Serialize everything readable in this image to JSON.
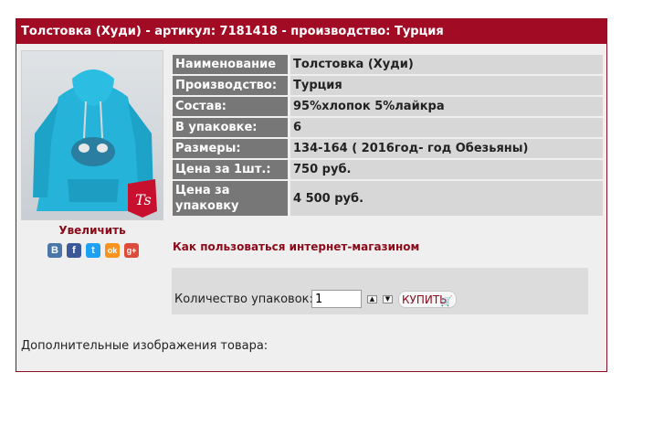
{
  "product": {
    "header": "Толстовка (Худи) - артикул: 7181418 - производство: Турция",
    "enlarge_label": "Увеличить",
    "specs": [
      {
        "key": "Наименование",
        "value": "Толстовка (Худи)"
      },
      {
        "key": "Производство:",
        "value": "Турция"
      },
      {
        "key": "Состав:",
        "value": "95%хлопок 5%лайкра"
      },
      {
        "key": "В упаковке:",
        "value": "6"
      },
      {
        "key": "Размеры:",
        "value": "134-164 ( 2016год- год Обезьяны)"
      },
      {
        "key": "Цена за 1шт.:",
        "value": "750 руб."
      },
      {
        "key": "Цена за упаковку",
        "value": "4 500 руб."
      }
    ],
    "howto_link": "Как пользоваться интернет-магазином",
    "qty_label": "Количество упаковок:",
    "qty_value": "1",
    "buy_label": "КУПИТЬ",
    "extra_images_label": "Дополнительные изображения товара:"
  },
  "social": [
    {
      "letter": "В",
      "icon": "vk-icon",
      "color": "#4a76a8"
    },
    {
      "letter": "f",
      "icon": "facebook-icon",
      "color": "#3b5998"
    },
    {
      "letter": "t",
      "icon": "twitter-icon",
      "color": "#1da1f2"
    },
    {
      "letter": "ok",
      "icon": "odnoklassniki-icon",
      "color": "#f7931e"
    },
    {
      "letter": "g+",
      "icon": "google-plus-icon",
      "color": "#dd4b39"
    }
  ],
  "colors": {
    "header_bg": "#a10c24",
    "link": "#8b0a19",
    "key_bg": "#777777",
    "value_bg": "#d7d7d7"
  }
}
